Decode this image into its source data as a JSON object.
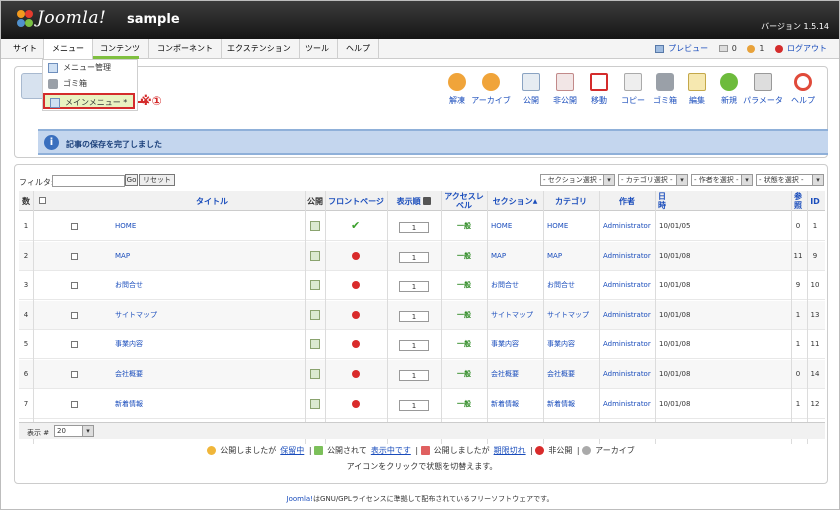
{
  "header": {
    "brand": "Joomla!",
    "site_name": "sample",
    "version": "バージョン 1.5.14"
  },
  "menubar": {
    "items": [
      "サイト",
      "メニュー",
      "コンテンツ",
      "コンポーネント",
      "エクステンション",
      "ツール",
      "ヘルプ"
    ],
    "preview": "プレビュー",
    "messages_count": "0",
    "users_count": "1",
    "logout": "ログアウト"
  },
  "dropdown": {
    "items": [
      "メニュー管理",
      "ゴミ箱",
      "メインメニュー *"
    ]
  },
  "annotation": "※①",
  "toolbar": {
    "buttons": [
      "解凍",
      "アーカイブ",
      "公開",
      "非公開",
      "移動",
      "コピー",
      "ゴミ箱",
      "編集",
      "新規",
      "パラメータ",
      "ヘルプ"
    ]
  },
  "message": "記事の保存を完了しました",
  "filter": {
    "label": "フィルタ:",
    "value": "",
    "go": "Go",
    "reset": "リセット",
    "selects": [
      "- セクション選択 -",
      "- カテゴリ選択 -",
      "- 作者を選択 -",
      "- 状態を選択 -"
    ]
  },
  "table": {
    "headers": {
      "num": "数",
      "title": "タイトル",
      "published": "公開",
      "frontpage": "フロントページ",
      "order": "表示順",
      "access": "アクセスレベル",
      "section": "セクション",
      "category": "カテゴリ",
      "author": "作者",
      "date": "日時",
      "hits": "参照",
      "id": "ID"
    },
    "rows": [
      {
        "num": "1",
        "title": "HOME",
        "frontpage": true,
        "order": "1",
        "access": "一般",
        "section": "HOME",
        "category": "HOME",
        "author": "Administrator",
        "date": "10/01/05",
        "hits": "0",
        "id": "1"
      },
      {
        "num": "2",
        "title": "MAP",
        "frontpage": false,
        "order": "1",
        "access": "一般",
        "section": "MAP",
        "category": "MAP",
        "author": "Administrator",
        "date": "10/01/08",
        "hits": "11",
        "id": "9"
      },
      {
        "num": "3",
        "title": "お問合せ",
        "frontpage": false,
        "order": "1",
        "access": "一般",
        "section": "お問合せ",
        "category": "お問合せ",
        "author": "Administrator",
        "date": "10/01/08",
        "hits": "9",
        "id": "10"
      },
      {
        "num": "4",
        "title": "サイトマップ",
        "frontpage": false,
        "order": "1",
        "access": "一般",
        "section": "サイトマップ",
        "category": "サイトマップ",
        "author": "Administrator",
        "date": "10/01/08",
        "hits": "1",
        "id": "13"
      },
      {
        "num": "5",
        "title": "事業内容",
        "frontpage": false,
        "order": "1",
        "access": "一般",
        "section": "事業内容",
        "category": "事業内容",
        "author": "Administrator",
        "date": "10/01/08",
        "hits": "1",
        "id": "11"
      },
      {
        "num": "6",
        "title": "会社概要",
        "frontpage": false,
        "order": "1",
        "access": "一般",
        "section": "会社概要",
        "category": "会社概要",
        "author": "Administrator",
        "date": "10/01/08",
        "hits": "0",
        "id": "14"
      },
      {
        "num": "7",
        "title": "新着情報",
        "frontpage": false,
        "order": "1",
        "access": "一般",
        "section": "新着情報",
        "category": "新着情報",
        "author": "Administrator",
        "date": "10/01/08",
        "hits": "1",
        "id": "12"
      }
    ]
  },
  "pager": {
    "label": "表示 #",
    "value": "20"
  },
  "legend": {
    "pending_a": "公開しましたが",
    "pending_b": "保留中",
    "current_a": "公開されて",
    "current_b": "表示中です",
    "expired_a": "公開しましたが",
    "expired_b": "期限切れ",
    "unpublished": "非公開",
    "archived": "アーカイブ",
    "hint": "アイコンをクリックで状態を切替えます。"
  },
  "footer": {
    "link": "Joomla!",
    "text": "はGNU/GPLライセンスに準拠して配布されているフリーソフトウェアです。"
  }
}
